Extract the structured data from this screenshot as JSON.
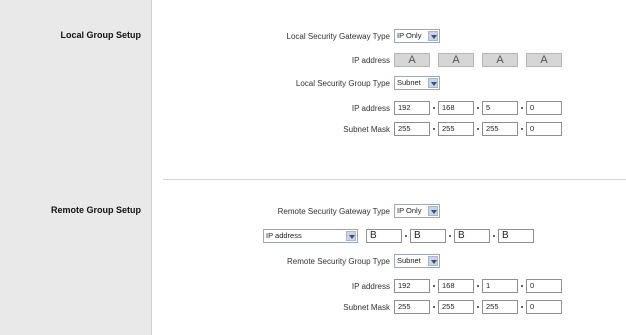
{
  "local": {
    "section_title": "Local Group Setup",
    "gateway_type_label": "Local Security Gateway Type",
    "gateway_type_value": "IP Only",
    "ip_label": "IP address",
    "ip_octets": [
      "A",
      "A",
      "A",
      "A"
    ],
    "group_type_label": "Local Security Group Type",
    "group_type_value": "Subnet",
    "group_ip_label": "IP address",
    "group_ip": [
      "192",
      "168",
      "5",
      "0"
    ],
    "mask_label": "Subnet Mask",
    "mask": [
      "255",
      "255",
      "255",
      "0"
    ]
  },
  "remote": {
    "section_title": "Remote Group Setup",
    "gateway_type_label": "Remote Security Gateway Type",
    "gateway_type_value": "IP Only",
    "ip_select_value": "IP address",
    "ip_octets": [
      "B",
      "B",
      "B",
      "B"
    ],
    "group_type_label": "Remote Security Group Type",
    "group_type_value": "Subnet",
    "group_ip_label": "IP address",
    "group_ip": [
      "192",
      "168",
      "1",
      "0"
    ],
    "mask_label": "Subnet Mask",
    "mask": [
      "255",
      "255",
      "255",
      "0"
    ]
  }
}
